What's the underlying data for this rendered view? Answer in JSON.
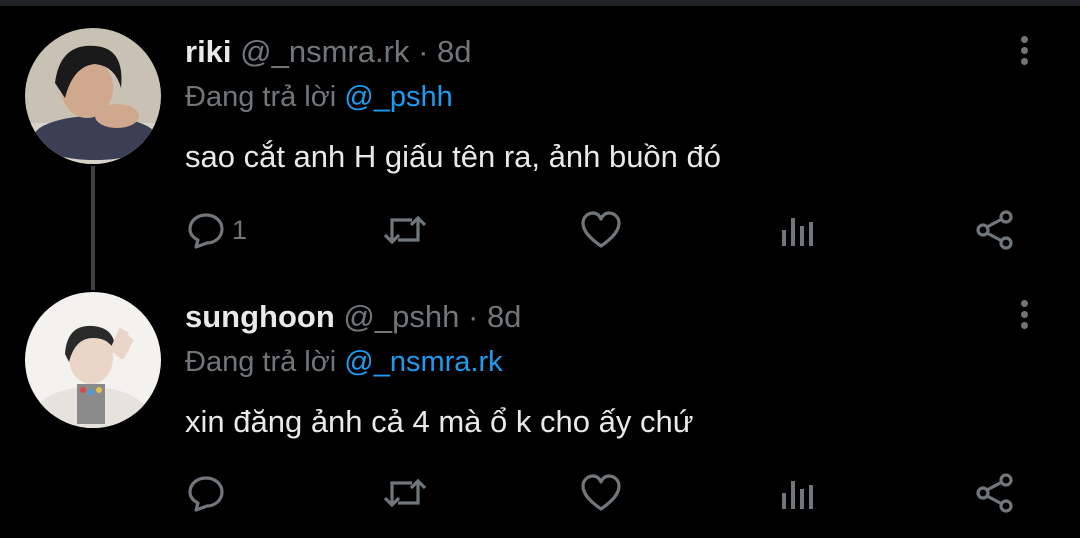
{
  "tweets": [
    {
      "name": "riki",
      "handle": "@_nsmra.rk",
      "separator": "·",
      "time": "8d",
      "replying_prefix": "Đang trả lời",
      "replying_to": "@_pshh",
      "text": "sao cắt anh H giấu tên ra, ảnh buồn đó",
      "reply_count": "1",
      "avatar_colors": {
        "bg": "#c9c2b4",
        "hair": "#1a1a1a",
        "skin": "#cfa88e",
        "shirt": "#3b3f55"
      }
    },
    {
      "name": "sunghoon",
      "handle": "@_pshh",
      "separator": "·",
      "time": "8d",
      "replying_prefix": "Đang trả lời",
      "replying_to": "@_nsmra.rk",
      "text": "xin đăng ảnh cả 4 mà ổ k cho ấy chứ",
      "reply_count": "",
      "avatar_colors": {
        "bg": "#f3f2ef",
        "hair": "#2a2a2a",
        "skin": "#e9d6c8",
        "shirt": "#e6e3dc"
      }
    }
  ],
  "icons": [
    "reply-icon",
    "retweet-icon",
    "like-icon",
    "analytics-icon",
    "share-icon",
    "more-icon"
  ],
  "colors": {
    "background": "#000000",
    "secondary_text": "#71767b",
    "link": "#1d9bf0",
    "primary_text": "#e7e9ea",
    "thread_line": "#3e4144"
  }
}
